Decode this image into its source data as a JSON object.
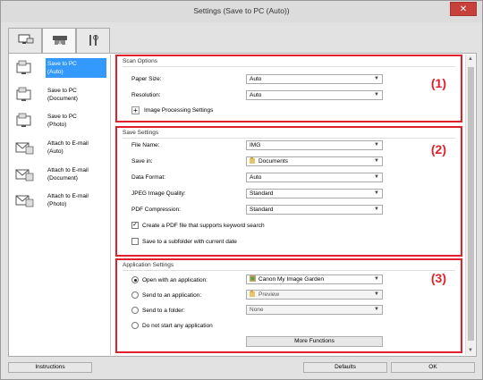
{
  "window": {
    "title": "Settings (Save to PC (Auto))",
    "close_glyph": "✕"
  },
  "tabs": [
    {
      "name": "scan-from-computer-icon"
    },
    {
      "name": "scan-from-panel-icon"
    },
    {
      "name": "general-settings-icon"
    }
  ],
  "sidebar": {
    "items": [
      {
        "line1": "Save to PC",
        "line2": "(Auto)",
        "icon": "pc-icon"
      },
      {
        "line1": "Save to PC",
        "line2": "(Document)",
        "icon": "pc-icon"
      },
      {
        "line1": "Save to PC",
        "line2": "(Photo)",
        "icon": "pc-icon"
      },
      {
        "line1": "Attach to E-mail",
        "line2": "(Auto)",
        "icon": "mail-icon"
      },
      {
        "line1": "Attach to E-mail",
        "line2": "(Document)",
        "icon": "mail-icon"
      },
      {
        "line1": "Attach to E-mail",
        "line2": "(Photo)",
        "icon": "mail-icon"
      }
    ]
  },
  "scan_options": {
    "title": "Scan Options",
    "annotation": "(1)",
    "paper_size_label": "Paper Size:",
    "paper_size_value": "Auto",
    "resolution_label": "Resolution:",
    "resolution_value": "Auto",
    "image_processing_label": "Image Processing Settings"
  },
  "save_settings": {
    "title": "Save Settings",
    "annotation": "(2)",
    "file_name_label": "File Name:",
    "file_name_value": "IMG",
    "save_in_label": "Save in:",
    "save_in_value": "Documents",
    "data_format_label": "Data Format:",
    "data_format_value": "Auto",
    "jpeg_quality_label": "JPEG Image Quality:",
    "jpeg_quality_value": "Standard",
    "pdf_compression_label": "PDF Compression:",
    "pdf_compression_value": "Standard",
    "pdf_keyword_label": "Create a PDF file that supports keyword search",
    "pdf_keyword_checked": true,
    "subfolder_label": "Save to a subfolder with current date",
    "subfolder_checked": false
  },
  "application_settings": {
    "title": "Application Settings",
    "annotation": "(3)",
    "open_app_label": "Open with an application:",
    "open_app_value": "Canon My Image Garden",
    "send_app_label": "Send to an application:",
    "send_app_value": "Preview",
    "send_folder_label": "Send to a folder:",
    "send_folder_value": "None",
    "no_app_label": "Do not start any application",
    "more_functions_label": "More Functions",
    "selected": "open_app"
  },
  "footer": {
    "instructions_label": "Instructions",
    "defaults_label": "Defaults",
    "ok_label": "OK"
  },
  "colors": {
    "annotation_red": "#e0202a",
    "selection_blue": "#3399ff"
  }
}
